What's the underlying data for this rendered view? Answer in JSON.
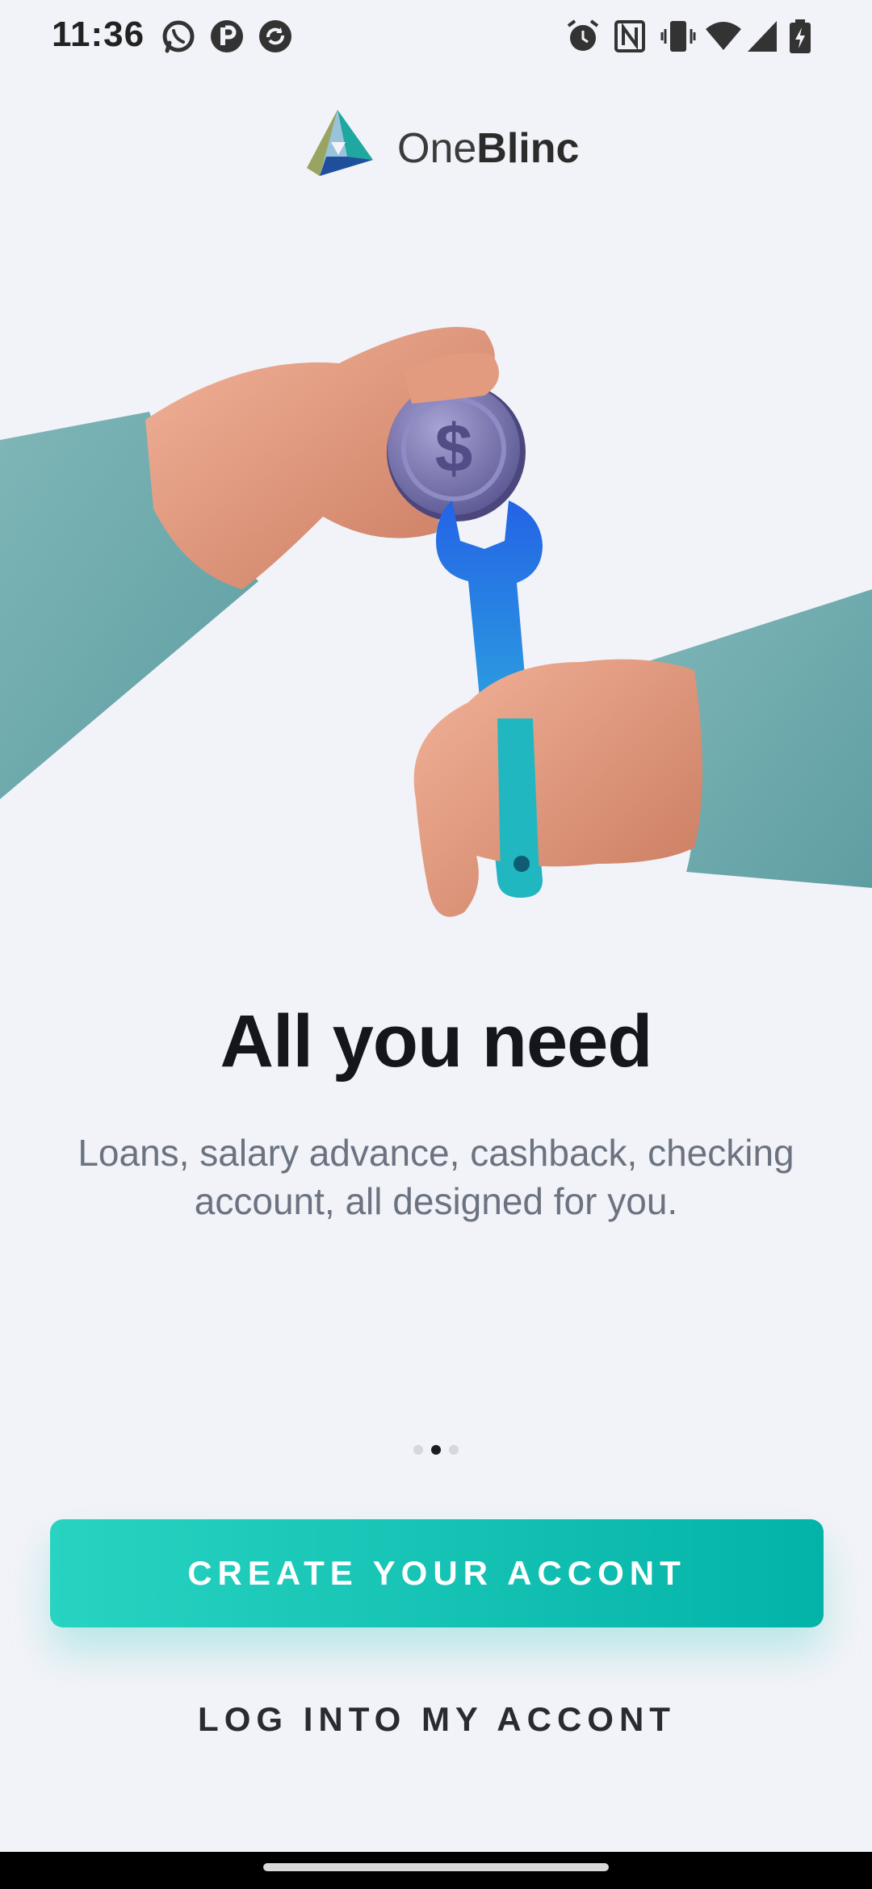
{
  "status_bar": {
    "time": "11:36",
    "left_icons": [
      "whatsapp-icon",
      "notification-p-icon",
      "sync-app-icon"
    ],
    "right_icons": [
      "alarm-icon",
      "nfc-icon",
      "vibrate-icon",
      "wifi-icon",
      "signal-icon",
      "battery-charging-icon"
    ]
  },
  "logo": {
    "text_regular": "One",
    "text_bold": "Blinc",
    "colors": [
      "#f4b81e",
      "#1ea8a0",
      "#1f4f9c"
    ]
  },
  "illustration": {
    "description_icons": [
      "coin-dollar-icon",
      "wrench-icon"
    ]
  },
  "onboarding": {
    "title": "All you need",
    "subtitle": "Loans, salary advance, cashback, checking account, all designed for you.",
    "page_count": 3,
    "active_page": 2
  },
  "actions": {
    "create_account_label": "CREATE YOUR ACCONT",
    "login_label": "LOG INTO MY ACCONT"
  },
  "colors": {
    "background": "#f2f3f8",
    "primary": "#12c0b2",
    "title": "#15161b",
    "subtitle": "#6b7280"
  }
}
